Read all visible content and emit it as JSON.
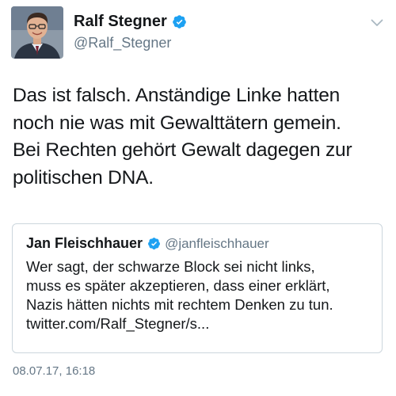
{
  "author": {
    "name": "Ralf Stegner",
    "handle": "@Ralf_Stegner",
    "verified": true
  },
  "tweet": {
    "lines": [
      "Das ist falsch. Anständige Linke hatten",
      "noch nie was mit Gewalttätern gemein.",
      "Bei Rechten gehört Gewalt dagegen zur",
      "politischen DNA."
    ]
  },
  "quoted_tweet": {
    "author_name": "Jan Fleischhauer",
    "author_handle": "@janfleischhauer",
    "verified": true,
    "lines": [
      "Wer sagt, der schwarze Block sei nicht links,",
      "muss es später akzeptieren, dass einer erklärt,",
      "Nazis hätten nichts mit rechtem Denken zu tun."
    ],
    "link": "twitter.com/Ralf_Stegner/s..."
  },
  "timestamp": "08.07.17, 16:18",
  "colors": {
    "verified_blue": "#1da1f2",
    "secondary_text": "#657786",
    "border": "#ccd6dd"
  },
  "icons": {
    "verified": "verified-badge-icon",
    "more": "chevron-down-icon"
  }
}
